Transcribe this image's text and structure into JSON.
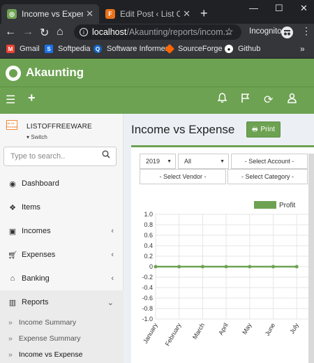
{
  "browser": {
    "tabs": [
      {
        "title": "Income vs Expense - A",
        "favicon_color": "#6da252",
        "active": true
      },
      {
        "title": "Edit Post ‹ List Of Freeware",
        "favicon_color": "#e8711a",
        "active": false
      }
    ],
    "url_host": "localhost",
    "url_path": "/Akaunting/reports/incom...",
    "incognito_label": "Incognito",
    "bookmarks": [
      {
        "label": "Gmail",
        "icon": "gmail-icon",
        "color": "#ea4335"
      },
      {
        "label": "Softpedia",
        "icon": "softpedia-icon",
        "color": "#1a73e8"
      },
      {
        "label": "Software Informer",
        "icon": "software-informer-icon",
        "color": "#1565c0"
      },
      {
        "label": "SourceForge",
        "icon": "sourceforge-icon",
        "color": "#ff6600"
      },
      {
        "label": "Github",
        "icon": "github-icon",
        "color": "#ffffff"
      }
    ]
  },
  "app": {
    "brand": "Akaunting",
    "accent": "#6da252",
    "company": {
      "name": "LISTOFFREEWARE",
      "switch_label": "Switch",
      "logo_text": "List Of Freeware"
    },
    "search_placeholder": "Type to search..",
    "menu": [
      {
        "label": "Dashboard",
        "icon": "dashboard-icon",
        "chevron": false
      },
      {
        "label": "Items",
        "icon": "cubes-icon",
        "chevron": false
      },
      {
        "label": "Incomes",
        "icon": "money-icon",
        "chevron": true
      },
      {
        "label": "Expenses",
        "icon": "cart-icon",
        "chevron": true
      },
      {
        "label": "Banking",
        "icon": "bank-icon",
        "chevron": true
      },
      {
        "label": "Reports",
        "icon": "bar-chart-icon",
        "chevron": true,
        "open": true
      }
    ],
    "report_submenu": [
      "Income Summary",
      "Expense Summary",
      "Income vs Expense"
    ],
    "page_title": "Income vs Expense",
    "print_label": "Print",
    "filters": {
      "year": "2019",
      "type": "All",
      "account_placeholder": "- Select Account -",
      "vendor_placeholder": "- Select Vendor -",
      "category_placeholder": "- Select Category -"
    }
  },
  "chart_data": {
    "type": "line",
    "title": "",
    "xlabel": "",
    "ylabel": "",
    "legend": {
      "placement": "top-right"
    },
    "categories": [
      "January",
      "February",
      "March",
      "April",
      "May",
      "June",
      "July"
    ],
    "series": [
      {
        "name": "Profit",
        "color": "#6da252",
        "values": [
          0,
          0,
          0,
          0,
          0,
          0,
          0
        ]
      }
    ],
    "yticks": [
      "1.0",
      "0.8",
      "0.6",
      "0.4",
      "0.2",
      "0",
      "-0.2",
      "-0.4",
      "-0.6",
      "-0.8",
      "-1.0"
    ],
    "ylim": [
      -1.0,
      1.0
    ],
    "grid": true
  }
}
